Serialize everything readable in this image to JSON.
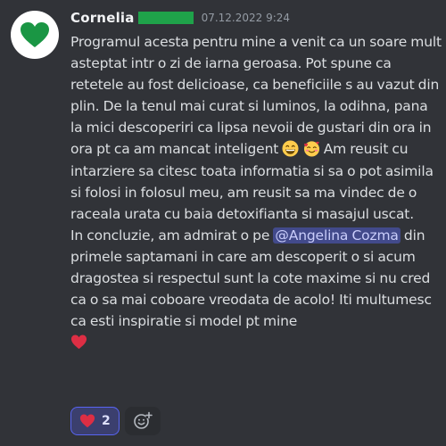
{
  "message": {
    "author": "Cornelia",
    "timestamp": "07.12.2022 9:24",
    "text_1": "Programul acesta pentru mine a venit ca un soare mult asteptat intr o zi de iarna geroasa. Pot spune ca retetele au fost delicioase, ca beneficiile s au vazut din plin. De la tenul mai curat si luminos, la odihna, pana la mici descoperiri ca lipsa nevoii de gustari din ora in ora pt ca am mancat inteligent ",
    "text_2": "  Am reusit cu intarziere sa citesc toata informatia si sa o pot asimila si folosi in folosul meu, am reusit sa ma vindec de o raceala urata cu baia detoxifianta si masajul uscat.",
    "text_3": "In concluzie, am admirat o pe ",
    "mention": "@Angelina Cozma",
    "text_4": " din primele saptamani in care am descoperit o si acum dragostea si respectul sunt la cote maxime si nu cred ca o sa mai coboare vreodata de acolo! Iti multumesc ca esti  inspiratie si model pt mine"
  },
  "reactions": [
    {
      "emoji": "heart-emoji",
      "count": "2"
    }
  ],
  "colors": {
    "background": "#313338",
    "text": "#dbdee1",
    "username": "#f2f3f5",
    "timestamp": "#949ba4",
    "avatar_heart": "#1a9644",
    "role_tag": "#1fa24a",
    "mention_bg": "#4e5296",
    "reaction_border": "#5865f2"
  },
  "icons": {
    "avatar": "green-heart-icon",
    "emoji_1": "grinning-face-emoji",
    "emoji_2": "smiling-face-with-hearts-emoji",
    "emoji_3": "red-heart-emoji",
    "add_reaction": "add-reaction-icon"
  }
}
